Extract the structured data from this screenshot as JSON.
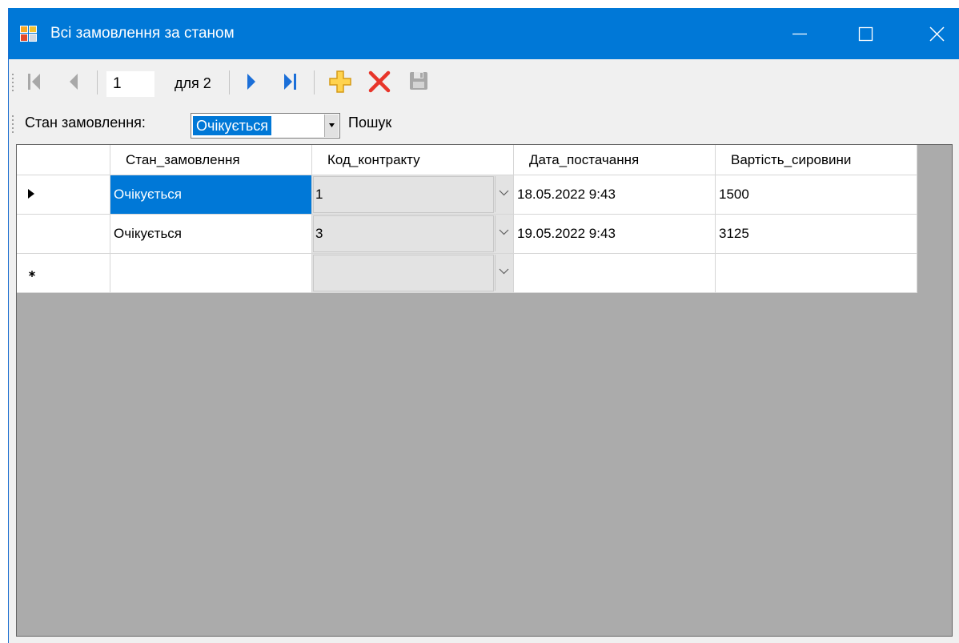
{
  "window": {
    "title": "Всі замовлення за станом",
    "accent_color": "#0078d7",
    "icon": "form-window-icon"
  },
  "navigator": {
    "position_value": "1",
    "count_label": "для 2",
    "buttons": [
      {
        "name": "move-first",
        "icon": "move-first-icon",
        "enabled": false
      },
      {
        "name": "move-previous",
        "icon": "move-previous-icon",
        "enabled": false
      },
      {
        "name": "move-next",
        "icon": "move-next-icon",
        "enabled": true
      },
      {
        "name": "move-last",
        "icon": "move-last-icon",
        "enabled": true
      },
      {
        "name": "add-new",
        "icon": "plus-icon",
        "enabled": true
      },
      {
        "name": "delete",
        "icon": "delete-x-icon",
        "enabled": true
      },
      {
        "name": "save",
        "icon": "save-disk-icon",
        "enabled": false
      }
    ]
  },
  "search": {
    "status_label": "Стан замовлення:",
    "status_value": "Очікується",
    "search_button": "Пошук"
  },
  "grid": {
    "columns": [
      "Стан_замовлення",
      "Код_контракту",
      "Дата_постачання",
      "Вартість_сировини"
    ],
    "rows": [
      {
        "marker": "current-row",
        "values": [
          "Очікується",
          "1",
          "18.05.2022 9:43",
          "1500"
        ]
      },
      {
        "marker": "",
        "values": [
          "Очікується",
          "3",
          "19.05.2022 9:43",
          "3125"
        ]
      }
    ],
    "new_row_marker": "*",
    "selected_cell_color": "#0078d7",
    "background_color": "#ababab"
  }
}
